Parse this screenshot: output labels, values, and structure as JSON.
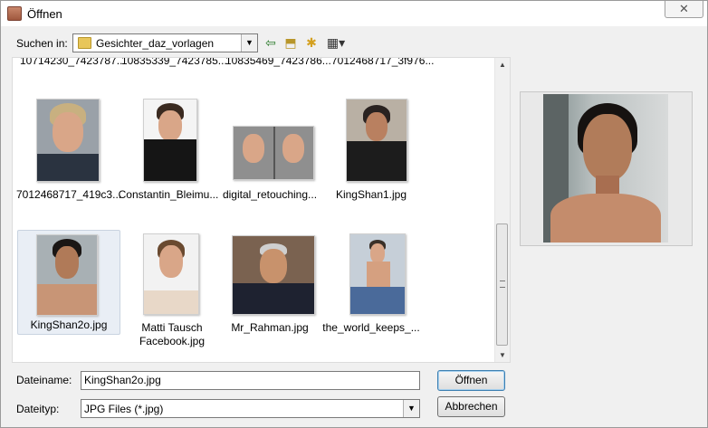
{
  "window": {
    "title": "Öffnen",
    "close_glyph": "✕"
  },
  "lookin": {
    "label": "Suchen in:",
    "value": "Gesichter_daz_vorlagen"
  },
  "toolbar": {
    "back_icon": "back-arrow-icon",
    "up_icon": "up-folder-icon",
    "new_icon": "new-folder-icon",
    "view_icon": "view-menu-icon"
  },
  "files": {
    "top_row": [
      "10714230_7423787...",
      "10835339_7423785...",
      "10835469_7423786...",
      "7012468717_3f976..."
    ],
    "row1": [
      {
        "name": "7012468717_419c3..."
      },
      {
        "name": "Constantin_Bleimu..."
      },
      {
        "name": "digital_retouching..."
      },
      {
        "name": "KingShan1.jpg"
      }
    ],
    "row2": [
      {
        "name": "KingShan2o.jpg"
      },
      {
        "name": "Matti Tausch",
        "name2": "Facebook.jpg"
      },
      {
        "name": "Mr_Rahman.jpg"
      },
      {
        "name": "the_world_keeps_..."
      }
    ],
    "selected": "KingShan2o.jpg"
  },
  "filename": {
    "label": "Dateiname:",
    "value": "KingShan2o.jpg"
  },
  "filetype": {
    "label": "Dateityp:",
    "value": "JPG Files (*.jpg)"
  },
  "buttons": {
    "open": "Öffnen",
    "cancel": "Abbrechen"
  }
}
